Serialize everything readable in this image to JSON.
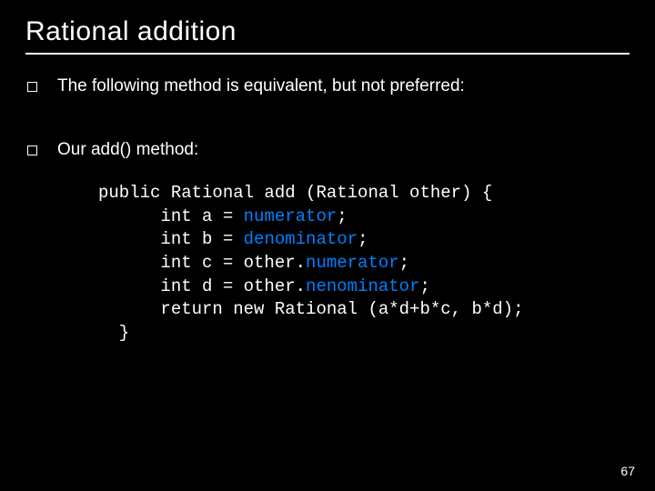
{
  "title": "Rational addition",
  "bullets": [
    "The following method is equivalent, but not preferred:",
    "Our add() method:"
  ],
  "code": {
    "l1a": "public Rational add (Rational other) {",
    "l2a": "      int a = ",
    "l2b": "numerator",
    "l2c": ";",
    "l3a": "      int b = ",
    "l3b": "denominator",
    "l3c": ";",
    "l4a": "      int c = other.",
    "l4b": "numerator",
    "l4c": ";",
    "l5a": "      int d = other.",
    "l5b": "nenominator",
    "l5c": ";",
    "l6a": "      return new Rational (a*d+b*c, b*d);",
    "l7a": "  }"
  },
  "page_number": "67"
}
